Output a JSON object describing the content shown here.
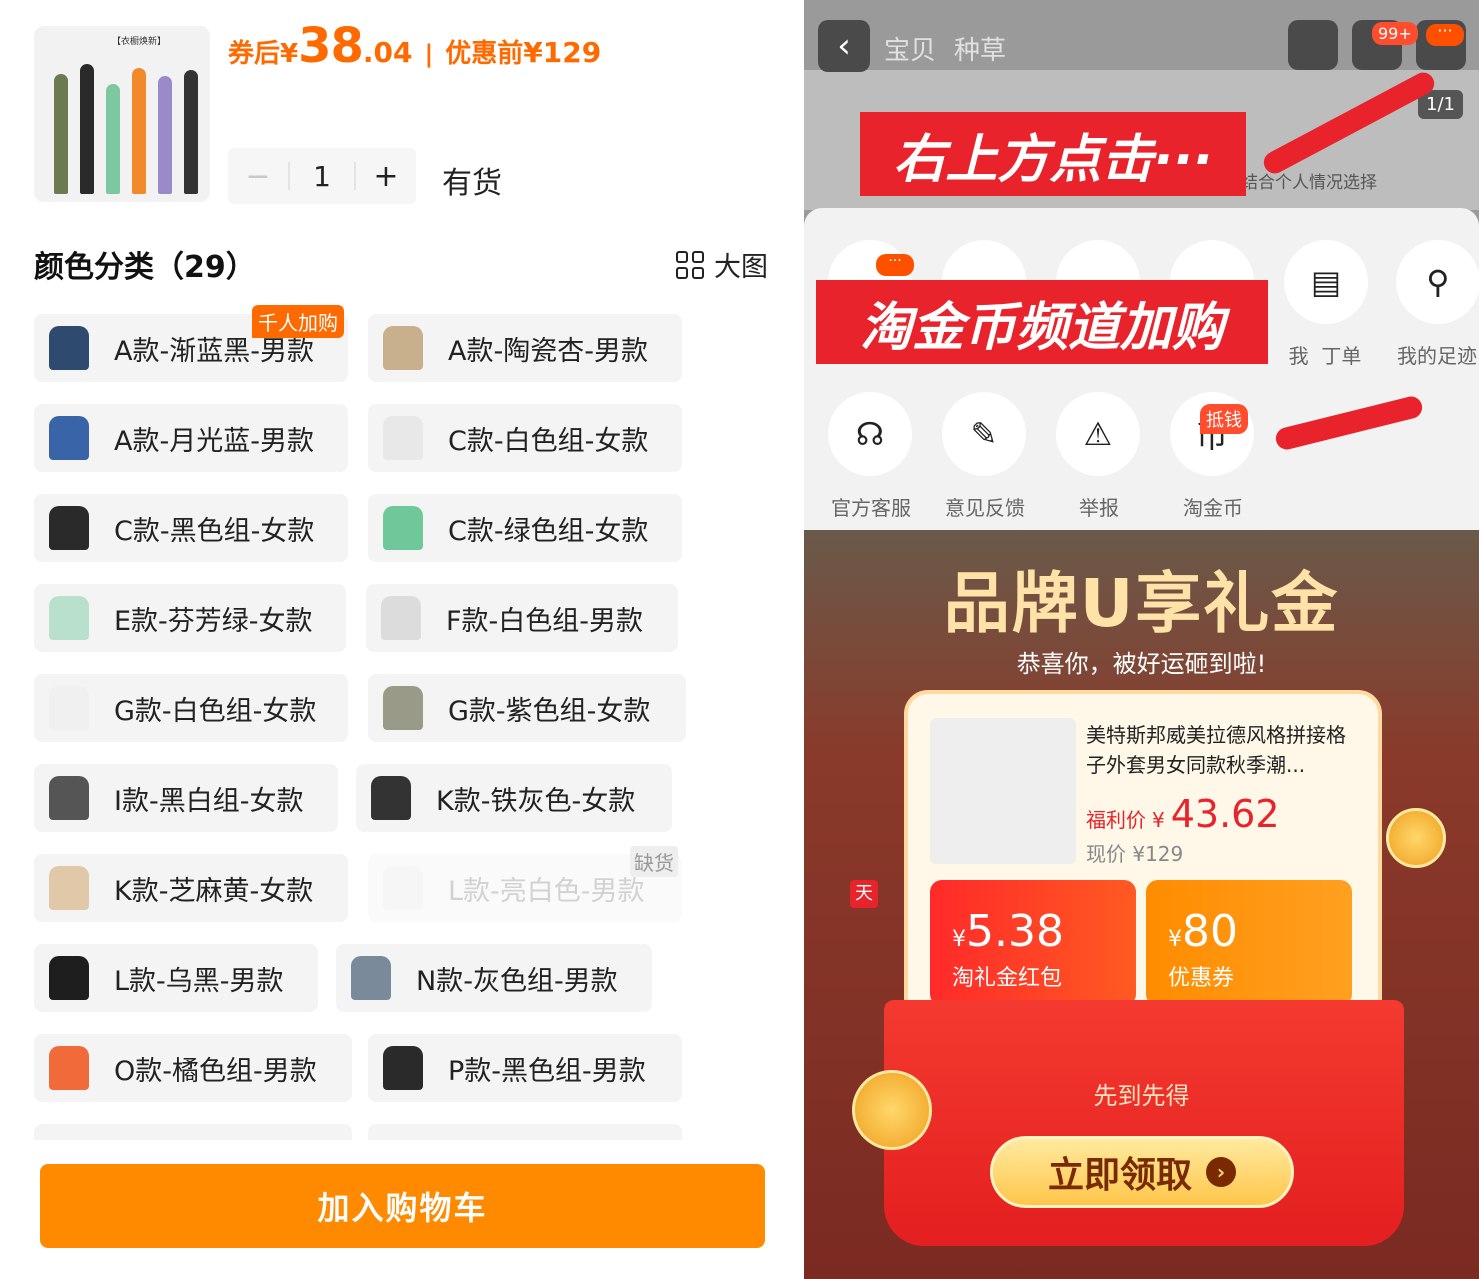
{
  "left": {
    "product_thumb_tag": "【衣橱焕新】",
    "price": {
      "after_coupon_label": "券后",
      "currency": "¥",
      "int": "38",
      "decimal": ".04",
      "separator": "|",
      "original_label": "优惠前",
      "original": "¥129"
    },
    "quantity": {
      "minus": "−",
      "value": "1",
      "plus": "+"
    },
    "stock": "有货",
    "category_title": "颜色分类（29）",
    "big_view_label": "大图",
    "badge_thousand": "千人加购",
    "badge_out": "缺货",
    "options": [
      {
        "label": "A款-渐蓝黑-男款",
        "color": "#2e4a6e"
      },
      {
        "label": "A款-陶瓷杏-男款",
        "color": "#c8b08c"
      },
      {
        "label": "A款-月光蓝-男款",
        "color": "#3a64a8"
      },
      {
        "label": "C款-白色组-女款",
        "color": "#e8e8e8"
      },
      {
        "label": "C款-黑色组-女款",
        "color": "#2a2a2a"
      },
      {
        "label": "C款-绿色组-女款",
        "color": "#6ec89a"
      },
      {
        "label": "E款-芬芳绿-女款",
        "color": "#b8e0cc"
      },
      {
        "label": "F款-白色组-男款",
        "color": "#dcdcdc"
      },
      {
        "label": "G款-白色组-女款",
        "color": "#f0f0f0"
      },
      {
        "label": "G款-紫色组-女款",
        "color": "#9a9a88"
      },
      {
        "label": "I款-黑白组-女款",
        "color": "#555555"
      },
      {
        "label": "K款-铁灰色-女款",
        "color": "#333333"
      },
      {
        "label": "K款-芝麻黄-女款",
        "color": "#e0c8a8"
      },
      {
        "label": "L款-亮白色-男款",
        "color": "#f6f6f6"
      },
      {
        "label": "L款-乌黑-男款",
        "color": "#1e1e1e"
      },
      {
        "label": "N款-灰色组-男款",
        "color": "#7a8a9a"
      },
      {
        "label": "O款-橘色组-男款",
        "color": "#f06a3a"
      },
      {
        "label": "P款-黑色组-男款",
        "color": "#2a2a2a"
      }
    ],
    "add_to_cart": "加入购物车"
  },
  "right": {
    "nav": {
      "tab1": "宝贝",
      "tab2": "种草",
      "badge": "99+",
      "more": "···",
      "page": "1/1"
    },
    "hint": "请结合个人情况选择",
    "callout_top": "右上方点击···",
    "callout_mid": "淘金币频道加购",
    "menu_top": [
      {
        "label": "我的订单",
        "icon": "clipboard-icon"
      },
      {
        "label": "我的足迹",
        "icon": "footprint-icon"
      }
    ],
    "menu_top_partial": [
      "我",
      "丁单"
    ],
    "menu_bottom": [
      {
        "label": "官方客服",
        "icon": "headset-icon",
        "glyph": "☊"
      },
      {
        "label": "意见反馈",
        "icon": "edit-icon",
        "glyph": "✎"
      },
      {
        "label": "举报",
        "icon": "warning-icon",
        "glyph": "⚠"
      },
      {
        "label": "淘金币",
        "icon": "coin-icon",
        "glyph": "币"
      }
    ],
    "coin_badge": "抵钱",
    "promo": {
      "title": "品牌U享礼金",
      "subtitle": "恭喜你，被好运砸到啦!",
      "product_name": "美特斯邦威美拉德风格拼接格子外套男女同款秋季潮...",
      "price_label": "福利价",
      "currency": "¥",
      "price": "43.62",
      "orig": "现价 ¥129",
      "coupon1_value": "5.38",
      "coupon1_label": "淘礼金红包",
      "coupon2_value": "80",
      "coupon2_label": "优惠券",
      "first_come": "先到先得",
      "claim": "立即领取",
      "side_tag": "天",
      "side_text": "美"
    }
  },
  "colors": {
    "accent": "#ff6a00",
    "cart": "#ff8a00",
    "red": "#e8232b"
  }
}
